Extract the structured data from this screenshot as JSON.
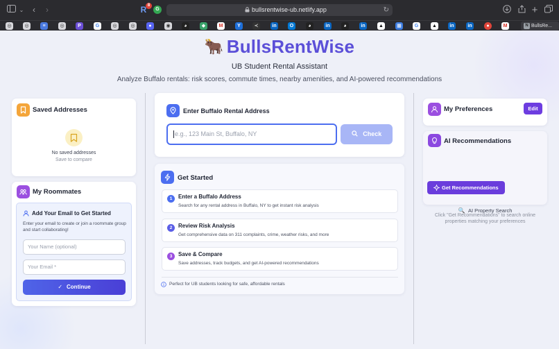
{
  "browser": {
    "url": "bullsrentwise-ub.netlify.app",
    "extension_badge": "8",
    "active_tab_label": "BullsRe...",
    "active_tab_icon_letter": "N"
  },
  "brand": {
    "emoji": "🐂",
    "name": "BullsRentWise"
  },
  "header": {
    "subtitle": "UB Student Rental Assistant",
    "tagline": "Analyze Buffalo rentals: risk scores, commute times, nearby amenities, and AI-powered recommendations"
  },
  "saved": {
    "title": "Saved Addresses",
    "empty_title": "No saved addresses",
    "empty_sub": "Save to compare"
  },
  "roommates": {
    "title": "My Roommates",
    "box_title": "Add Your Email to Get Started",
    "box_desc": "Enter your email to create or join a roommate group and start collaborating!",
    "name_placeholder": "Your Name (optional)",
    "email_placeholder": "Your Email *",
    "continue_label": "Continue"
  },
  "address": {
    "title": "Enter Buffalo Rental Address",
    "placeholder": "e.g., 123 Main St, Buffalo, NY",
    "check_label": "Check"
  },
  "get_started": {
    "title": "Get Started",
    "steps": [
      {
        "num": "1",
        "title": "Enter a Buffalo Address",
        "desc": "Search for any rental address in Buffalo, NY to get instant risk analysis"
      },
      {
        "num": "2",
        "title": "Review Risk Analysis",
        "desc": "Get comprehensive data on 311 complaints, crime, weather risks, and more"
      },
      {
        "num": "3",
        "title": "Save & Compare",
        "desc": "Save addresses, track budgets, and get AI-powered recommendations"
      }
    ],
    "footer": "Perfect for UB students looking for safe, affordable rentals"
  },
  "preferences": {
    "title": "My Preferences",
    "edit_label": "Edit"
  },
  "ai": {
    "title": "AI Recommendations",
    "button_label": "Get Recommendations",
    "search_title": "AI Property Search",
    "search_desc_line1": "Click \"Get Recommendations\" to search online",
    "search_desc_line2": "properties matching your preferences"
  },
  "colors": {
    "brand": "#5b4fd8",
    "primary_blue": "#4c6ef0",
    "purple": "#6d3de0",
    "saved_icon": "#f4a53a",
    "roommates_icon": "#9b4fe0"
  }
}
